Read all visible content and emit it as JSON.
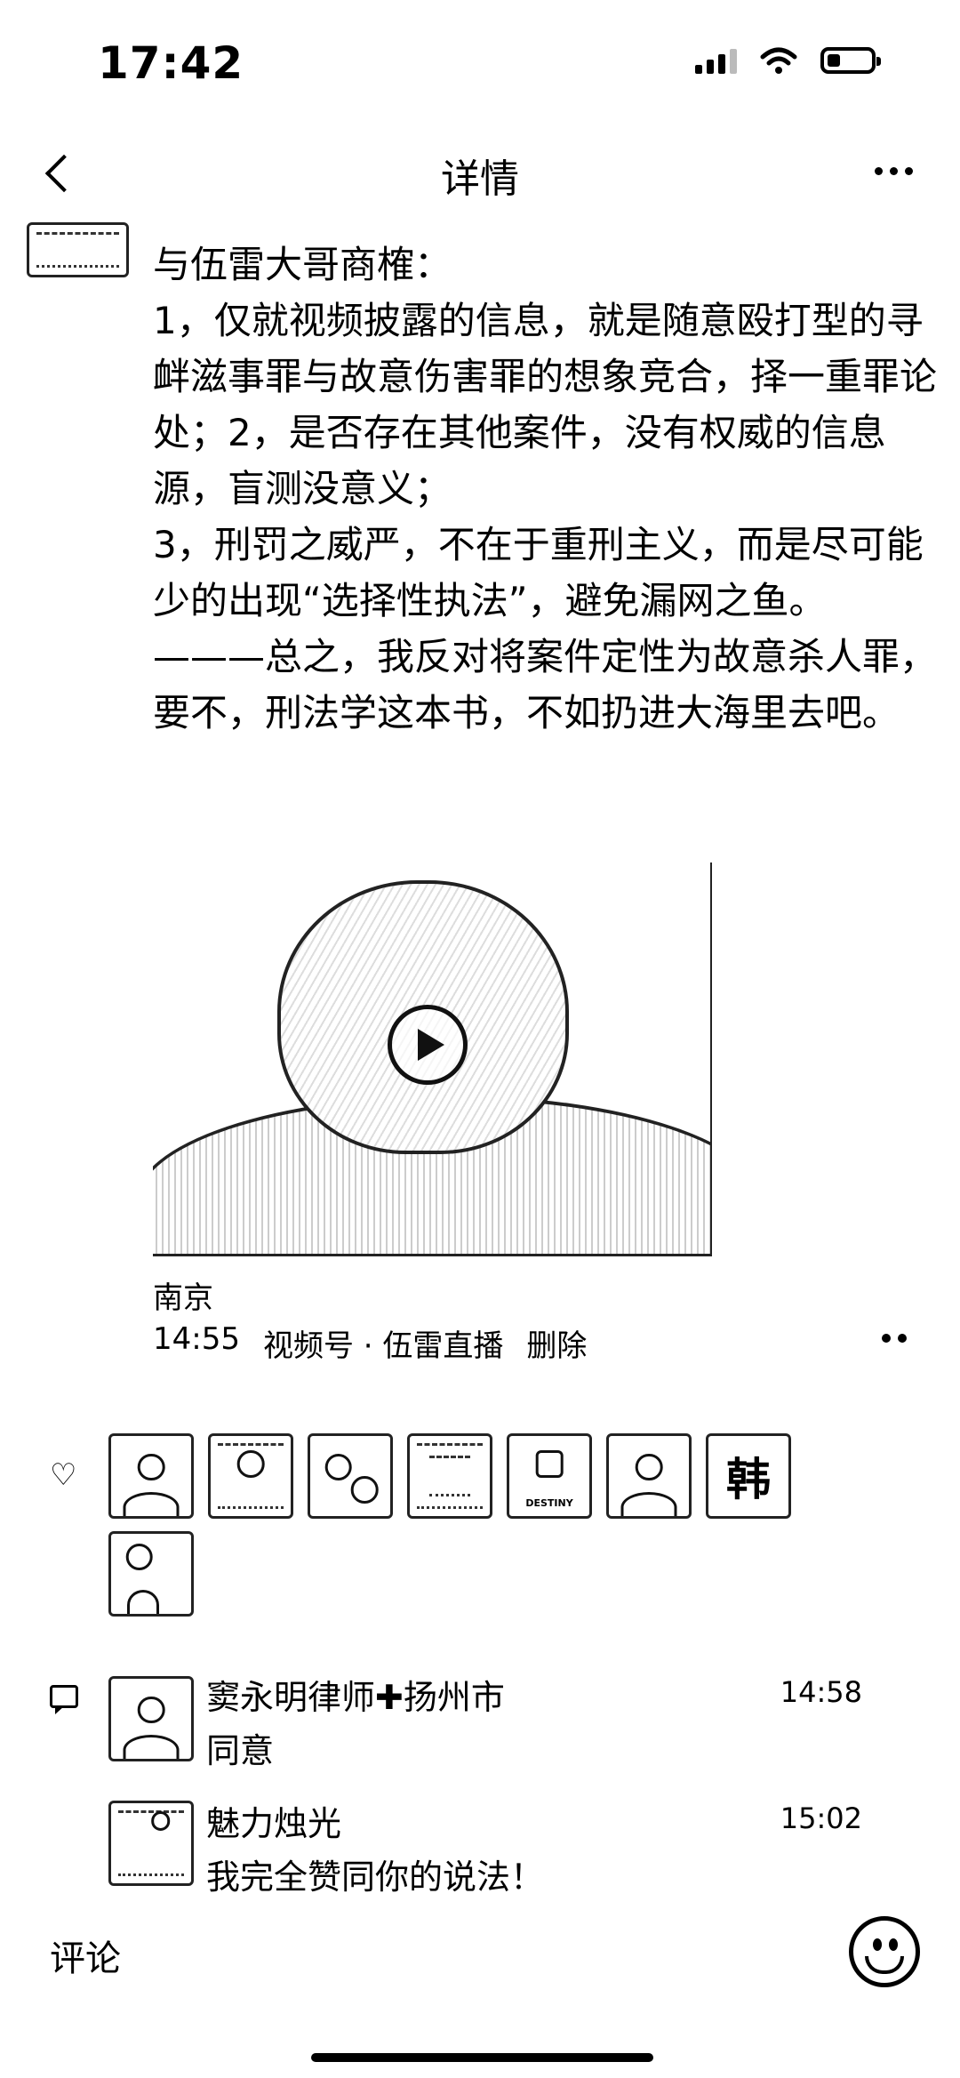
{
  "status_bar": {
    "time": "17:42"
  },
  "nav": {
    "title": "详情"
  },
  "post": {
    "text": "与伍雷大哥商榷：\n1，仅就视频披露的信息，就是随意殴打型的寻衅滋事罪与故意伤害罪的想象竞合，择一重罪论处；2，是否存在其他案件，没有权威的信息源，盲测没意义；\n3，刑罚之威严，不在于重刑主义，而是尽可能少的出现“选择性执法”，避免漏网之鱼。\n———总之，我反对将案件定性为故意杀人罪，要不，刑法学这本书，不如扔进大海里去吧。",
    "location": "南京",
    "time": "14:55",
    "source": "视频号 · 伍雷直播",
    "delete_label": "删除"
  },
  "likes": {
    "avatars": [
      "avatar-1",
      "avatar-2",
      "avatar-3",
      "avatar-4",
      "avatar-5",
      "avatar-6",
      "avatar-7",
      "avatar-8"
    ],
    "text_avatar_glyph": "韩",
    "badge_text": "DESTINY"
  },
  "comments": [
    {
      "name": "窦永明律师✚扬州市",
      "time": "14:58",
      "text": "同意"
    },
    {
      "name": "魅力烛光",
      "time": "15:02",
      "text": "我完全赞同你的说法！"
    }
  ],
  "comment_box": {
    "placeholder": "评论"
  }
}
